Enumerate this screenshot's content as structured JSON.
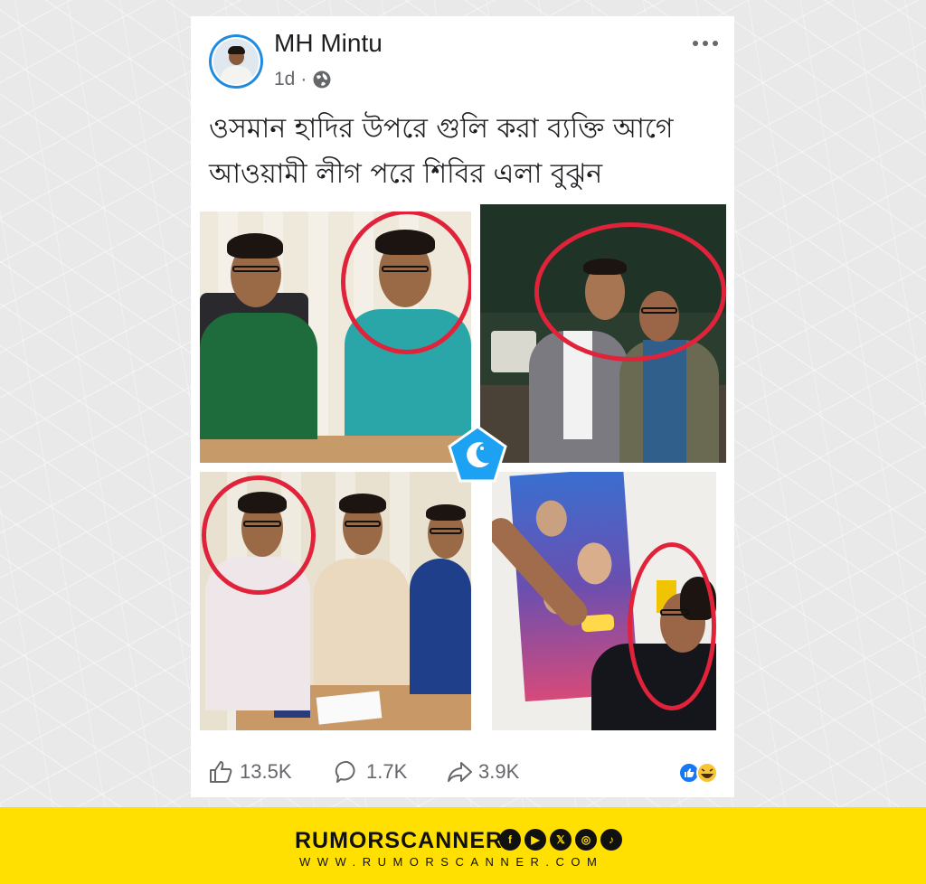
{
  "post": {
    "author": "MH Mintu",
    "time": "1d",
    "separator": "·",
    "caption_line1": "ওসমান হাদির উপরে গুলি করা ব্যক্তি আগে",
    "caption_line2": "আওয়ামী লীগ পরে শিবির এলা বুঝুন",
    "icons": [
      "avatar",
      "globe-icon",
      "more-icon"
    ]
  },
  "collage": {
    "highlight_color": "#e0233a",
    "badge_color": "#1da1f2"
  },
  "actions": {
    "likes": "13.5K",
    "comments": "1.7K",
    "shares": "3.9K",
    "icons": [
      "like-icon",
      "comment-icon",
      "share-icon",
      "like-reaction-icon",
      "haha-reaction-icon"
    ]
  },
  "footer": {
    "brand": "RUMORSCANNER",
    "url": "WWW.RUMORSCANNER.COM",
    "social_icons": [
      "facebook-icon",
      "youtube-icon",
      "x-icon",
      "instagram-icon",
      "tiktok-icon"
    ],
    "background": "#ffe000"
  }
}
